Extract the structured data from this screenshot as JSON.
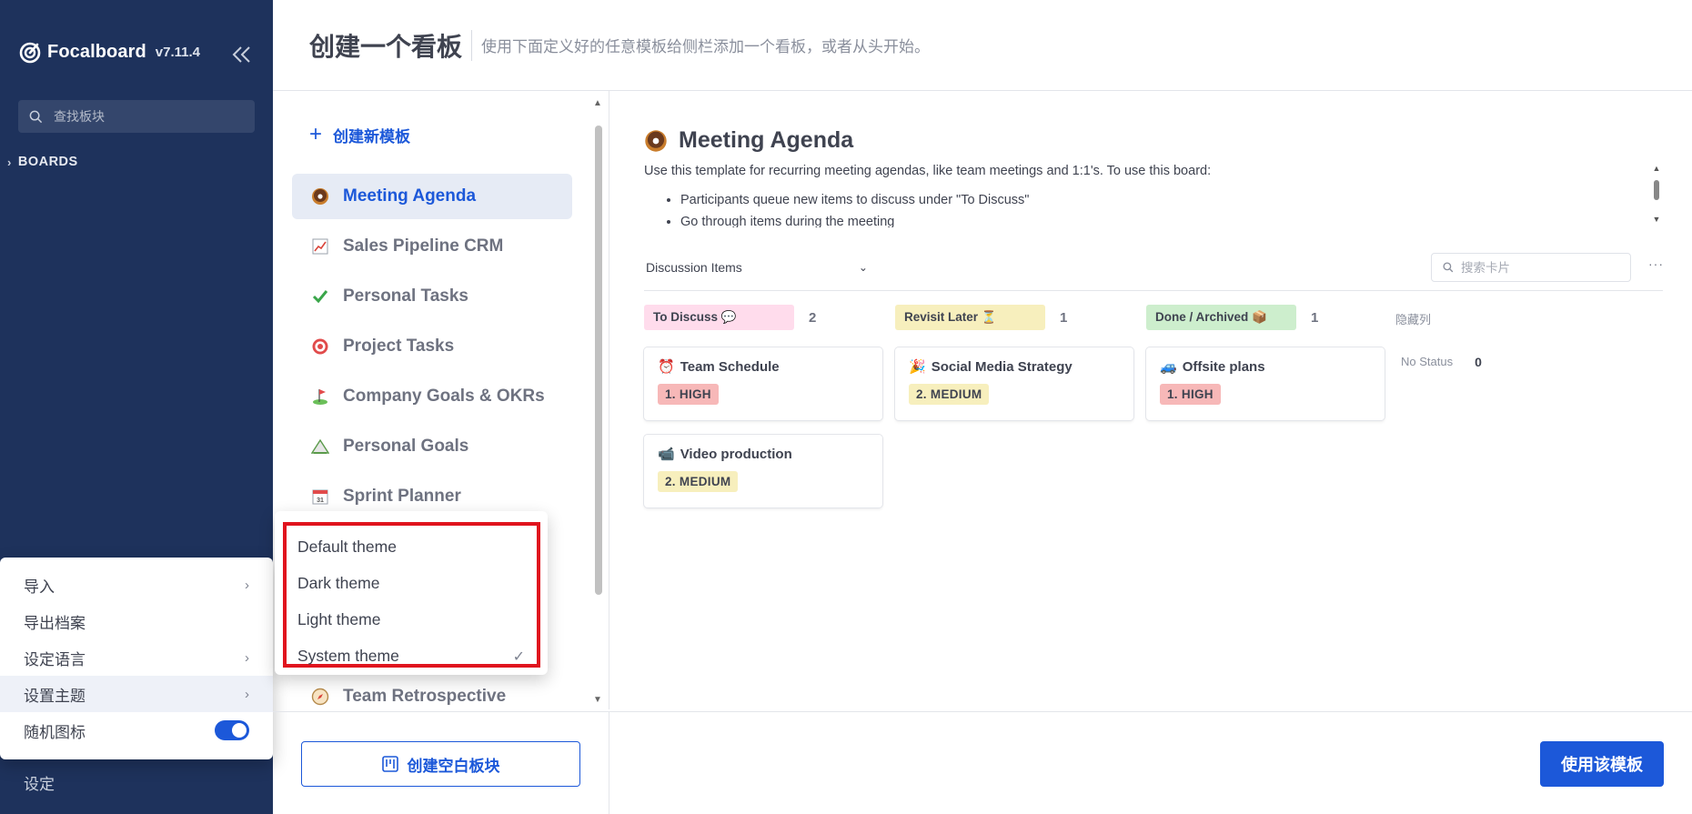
{
  "sidebar": {
    "brand_name": "Focalboard",
    "version": "v7.11.4",
    "search_placeholder": "查找板块",
    "boards_label": "BOARDS",
    "settings_label": "设定"
  },
  "settings_menu": {
    "items": [
      {
        "label": "导入"
      },
      {
        "label": "导出档案"
      },
      {
        "label": "设定语言"
      },
      {
        "label": "设置主题"
      },
      {
        "label": "随机图标"
      }
    ]
  },
  "theme_menu": {
    "items": [
      {
        "label": "Default theme"
      },
      {
        "label": "Dark theme"
      },
      {
        "label": "Light theme"
      },
      {
        "label": "System theme"
      }
    ],
    "checked": "System theme"
  },
  "header": {
    "title": "创建一个看板",
    "subtitle": "使用下面定义好的任意模板给侧栏添加一个看板，或者从头开始。"
  },
  "templates": {
    "new_template_label": "创建新模板",
    "items": [
      {
        "label": "Meeting Agenda",
        "icon": "donut-icon"
      },
      {
        "label": "Sales Pipeline CRM",
        "icon": "chart-icon"
      },
      {
        "label": "Personal Tasks",
        "icon": "check-icon"
      },
      {
        "label": "Project Tasks",
        "icon": "target-icon"
      },
      {
        "label": "Company Goals & OKRs",
        "icon": "golf-icon"
      },
      {
        "label": "Personal Goals",
        "icon": "mountain-icon"
      },
      {
        "label": "Sprint Planner",
        "icon": "calendar-icon"
      },
      {
        "label": "Team Retrospective",
        "icon": "compass-icon"
      }
    ]
  },
  "actions": {
    "empty_board": "创建空白板块",
    "use_template": "使用该模板"
  },
  "preview": {
    "title": "Meeting Agenda",
    "description": "Use this template for recurring meeting agendas, like team meetings and 1:1's. To use this board:",
    "bullets": [
      "Participants queue new items to discuss under \"To Discuss\"",
      "Go through items during the meeting"
    ],
    "view_name": "Discussion Items",
    "card_search_placeholder": "搜索卡片",
    "hidden_columns_label": "隐藏列",
    "no_status_label": "No Status",
    "no_status_count": "0",
    "columns": [
      {
        "label": "To Discuss 💬",
        "count": "2",
        "color": "#ffdcec"
      },
      {
        "label": "Revisit Later ⏳",
        "count": "1",
        "color": "#f7efbd"
      },
      {
        "label": "Done / Archived 📦",
        "count": "1",
        "color": "#cdeecd"
      }
    ],
    "cards": [
      {
        "title": "Team Schedule",
        "emoji": "⏰",
        "priority": "1. HIGH",
        "priority_color": "#f7b8b8"
      },
      {
        "title": "Social Media Strategy",
        "emoji": "🎉",
        "priority": "2. MEDIUM",
        "priority_color": "#f7efbd"
      },
      {
        "title": "Offsite plans",
        "emoji": "🚙",
        "priority": "1. HIGH",
        "priority_color": "#f7b8b8"
      },
      {
        "title": "Video production",
        "emoji": "📹",
        "priority": "2. MEDIUM",
        "priority_color": "#f7efbd"
      }
    ]
  },
  "colors": {
    "sidebar_bg": "#1e325c",
    "accent": "#1c58d9",
    "highlight_border": "#e0141e"
  }
}
